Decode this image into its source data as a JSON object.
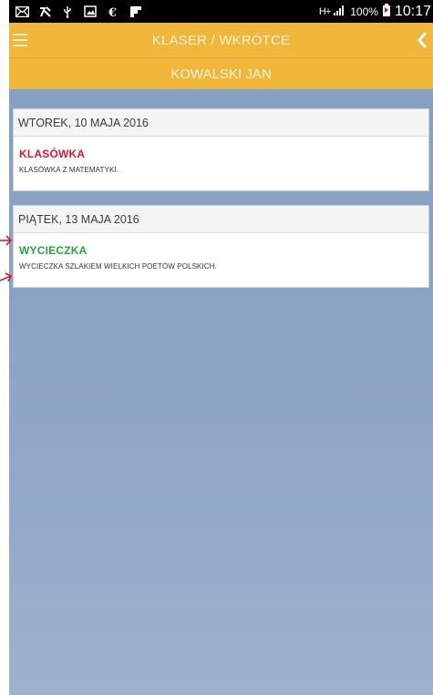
{
  "statusbar": {
    "icons": [
      "mail-icon",
      "app-icon",
      "usb-icon",
      "image-icon",
      "news-icon",
      "flipboard-icon"
    ],
    "network": "H+",
    "battery": "100%",
    "time": "10:17"
  },
  "appbar": {
    "title": "KLASER / WKRÓTCE"
  },
  "student": {
    "name": "KOWALSKI JAN"
  },
  "events": [
    {
      "date": "WTOREK, 10 MAJA 2016",
      "title": "KLASÓWKA",
      "title_color": "#e0162b",
      "description": "KLASÓWKA Z MATEMATYKI."
    },
    {
      "date": "PIĄTEK, 13 MAJA 2016",
      "title": "WYCIECZKA",
      "title_color": "#22a83a",
      "description": "WYCIECZKA SZLAKIEM WIELKICH POETÓW POLSKICH."
    }
  ],
  "colors": {
    "appbar": "#f0b73a",
    "annotation_arrow": "#e0162b"
  }
}
